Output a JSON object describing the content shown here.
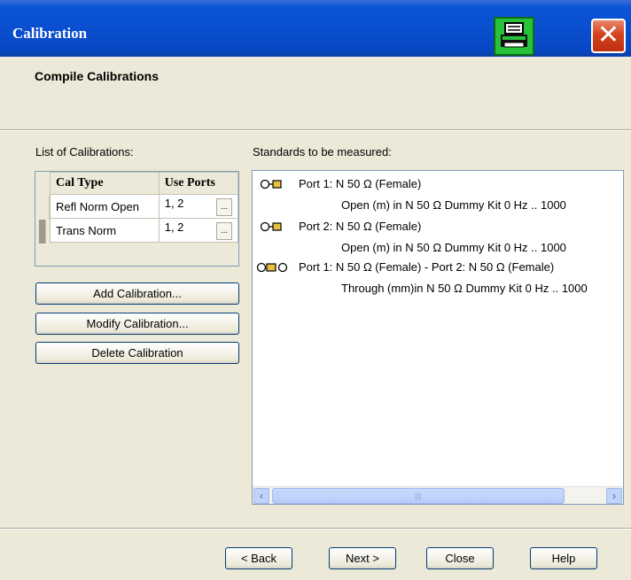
{
  "window": {
    "title": "Calibration"
  },
  "header": {
    "subtitle": "Compile Calibrations"
  },
  "calibrations": {
    "label": "List of Calibrations:",
    "columns": [
      "Cal Type",
      "Use Ports"
    ],
    "rows": [
      {
        "cal_type": "Refl Norm Open",
        "ports": "1, 2",
        "more": "..."
      },
      {
        "cal_type": "Trans Norm",
        "ports": "1, 2",
        "more": "..."
      }
    ],
    "buttons": {
      "add": "Add Calibration...",
      "modify": "Modify Calibration...",
      "delete": "Delete Calibration"
    }
  },
  "standards": {
    "label": "Standards to be measured:",
    "items": [
      {
        "header": "Port 1: N 50 Ω (Female)",
        "detail": "Open (m)      in N 50 Ω Dummy Kit  0 Hz  .. 1000"
      },
      {
        "header": "Port 2: N 50 Ω (Female)",
        "detail": "Open (m)      in N 50 Ω Dummy Kit  0 Hz  .. 1000"
      },
      {
        "header": "Port 1: N 50 Ω (Female) - Port 2: N 50 Ω (Female)",
        "detail": "Through (mm)in N 50 Ω Dummy Kit  0 Hz  .. 1000"
      }
    ]
  },
  "footer": {
    "back": "< Back",
    "next": "Next >",
    "close": "Close",
    "help": "Help"
  },
  "icons": {
    "print": "printer-icon",
    "close": "close-icon"
  }
}
